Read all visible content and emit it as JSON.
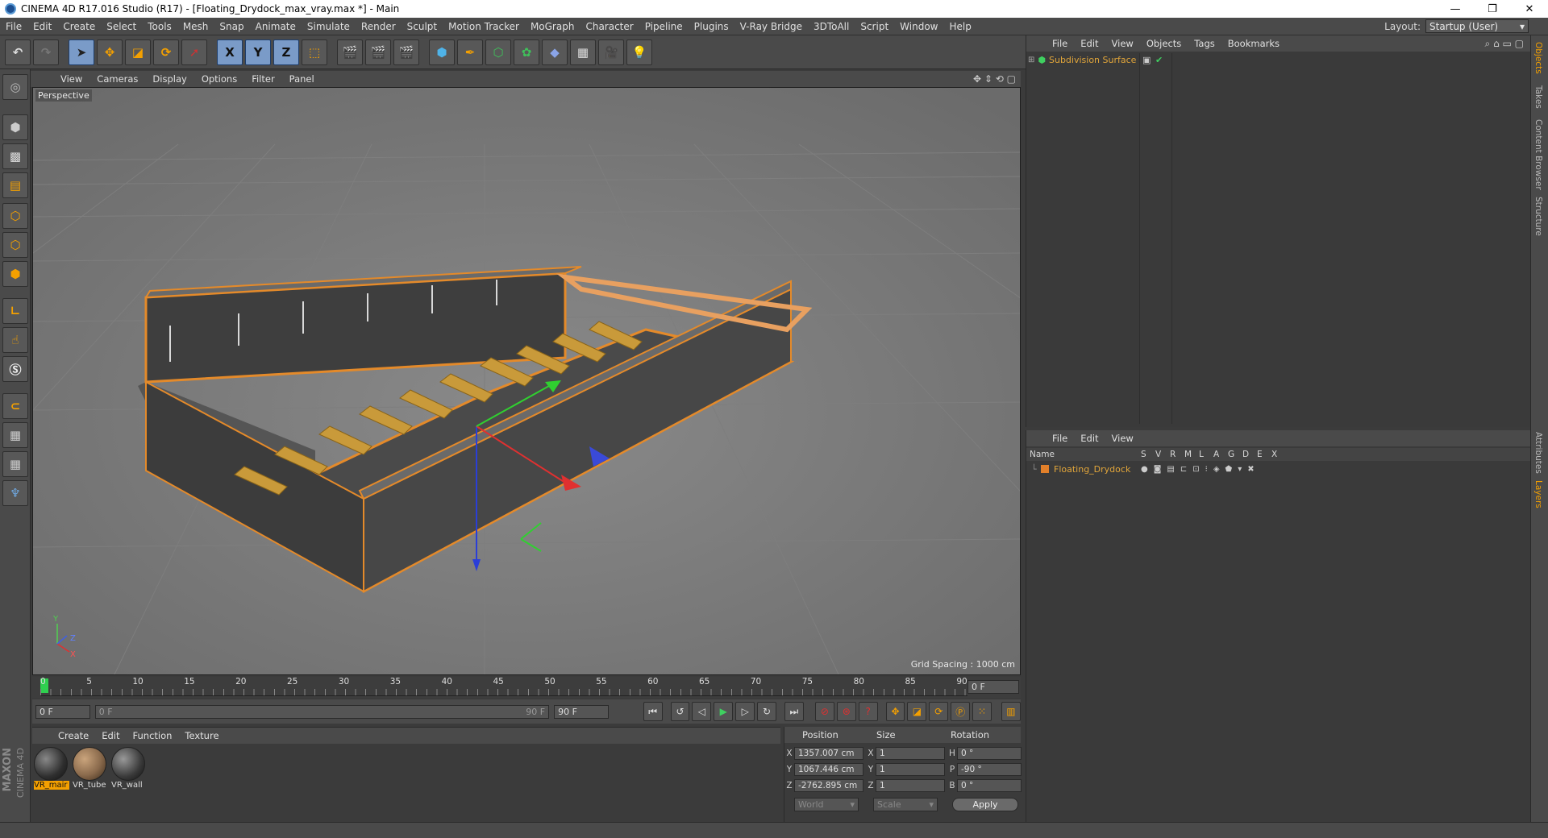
{
  "window": {
    "title": "CINEMA 4D R17.016 Studio (R17) - [Floating_Drydock_max_vray.max *] - Main",
    "minimize": "—",
    "restore": "❐",
    "close": "✕"
  },
  "menu": [
    "File",
    "Edit",
    "Create",
    "Select",
    "Tools",
    "Mesh",
    "Snap",
    "Animate",
    "Simulate",
    "Render",
    "Sculpt",
    "Motion Tracker",
    "MoGraph",
    "Character",
    "Pipeline",
    "Plugins",
    "V-Ray Bridge",
    "3DToAll",
    "Script",
    "Window",
    "Help"
  ],
  "layout": {
    "label": "Layout:",
    "value": "Startup (User)"
  },
  "toolbar": {
    "x": "X",
    "y": "Y",
    "z": "Z"
  },
  "viewport": {
    "menu": [
      "View",
      "Cameras",
      "Display",
      "Options",
      "Filter",
      "Panel"
    ],
    "name": "Perspective",
    "grid_spacing": "Grid Spacing : 1000 cm",
    "axis_y": "Y",
    "axis_z": "Z",
    "axis_x": "X"
  },
  "timeline": {
    "ticks": [
      "0",
      "5",
      "10",
      "15",
      "20",
      "25",
      "30",
      "35",
      "40",
      "45",
      "50",
      "55",
      "60",
      "65",
      "70",
      "75",
      "80",
      "85",
      "90"
    ],
    "current": "0 F"
  },
  "transport": {
    "start": "0 F",
    "range_start": "0 F",
    "range_end": "90 F",
    "end": "90 F"
  },
  "materials": {
    "menu": [
      "Create",
      "Edit",
      "Function",
      "Texture"
    ],
    "items": [
      {
        "name": "VR_mair",
        "color": "#2f2f2f"
      },
      {
        "name": "VR_tube",
        "color": "#8a6a4c"
      },
      {
        "name": "VR_wall",
        "color": "#3a3a3a"
      }
    ]
  },
  "coords": {
    "headers": {
      "position": "Position",
      "size": "Size",
      "rotation": "Rotation"
    },
    "rows": [
      {
        "axis": "X",
        "pos": "1357.007 cm",
        "size_axis": "X",
        "size": "1",
        "rot_axis": "H",
        "rot": "0 °"
      },
      {
        "axis": "Y",
        "pos": "1067.446 cm",
        "size_axis": "Y",
        "size": "1",
        "rot_axis": "P",
        "rot": "-90 °"
      },
      {
        "axis": "Z",
        "pos": "-2762.895 cm",
        "size_axis": "Z",
        "size": "1",
        "rot_axis": "B",
        "rot": "0 °"
      }
    ],
    "world": "World",
    "scale": "Scale",
    "apply": "Apply"
  },
  "objects_panel": {
    "menu": [
      "File",
      "Edit",
      "View",
      "Objects",
      "Tags",
      "Bookmarks"
    ],
    "items": [
      {
        "name": "Subdivision Surface",
        "color": "#e2a63a"
      }
    ]
  },
  "layers_panel": {
    "menu": [
      "File",
      "Edit",
      "View"
    ],
    "columns": [
      "Name",
      "S",
      "V",
      "R",
      "M",
      "L",
      "A",
      "G",
      "D",
      "E",
      "X"
    ],
    "items": [
      {
        "name": "Floating_Drydock",
        "color": "#e2802a"
      }
    ]
  },
  "side_tabs": [
    "Objects",
    "Takes",
    "Content Browser",
    "Structure",
    "Attributes",
    "Layers"
  ],
  "brand": {
    "maxon": "MAXON",
    "c4d": "CINEMA 4D"
  }
}
